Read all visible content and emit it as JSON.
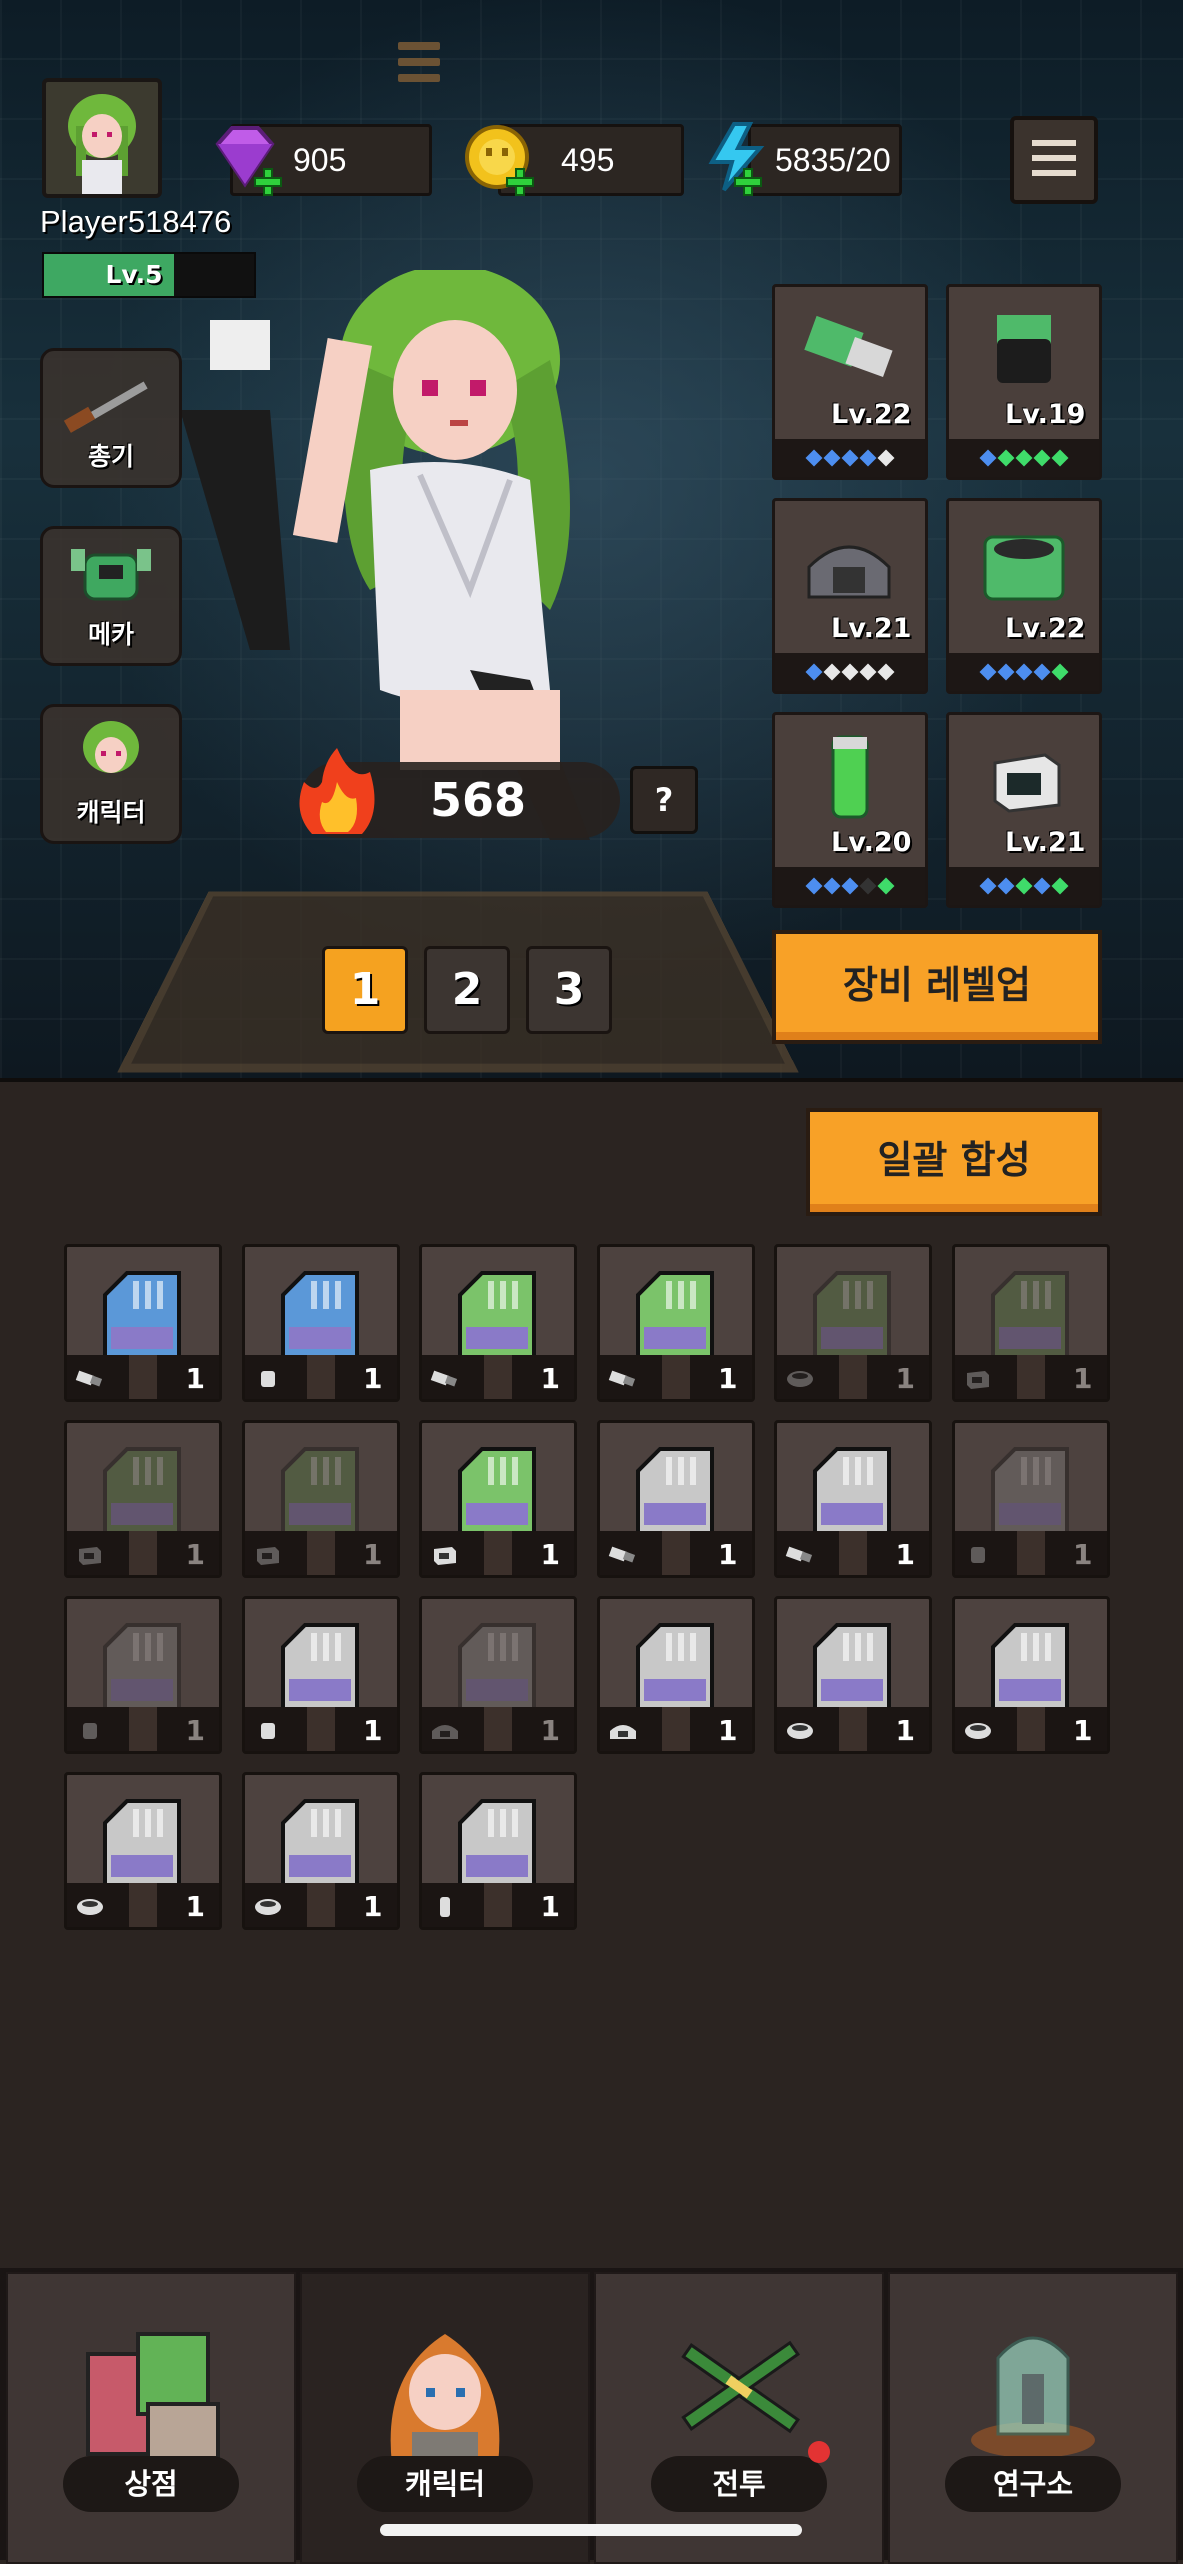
{
  "player": {
    "name": "Player518476",
    "level_text": "Lv.5",
    "exp_progress": 0.62
  },
  "resources": {
    "gems": "905",
    "gold": "495",
    "energy": "5835/20"
  },
  "menu_icon": "hamburger-menu-icon",
  "side_menu": [
    {
      "label": "총기",
      "icon": "rifle-icon"
    },
    {
      "label": "메카",
      "icon": "mech-icon"
    },
    {
      "label": "캐릭터",
      "icon": "character-icon"
    }
  ],
  "combat_power": {
    "value": "568",
    "help": "?"
  },
  "presets": [
    "1",
    "2",
    "3"
  ],
  "equipment": [
    {
      "level": "Lv.22",
      "stars": [
        "blue",
        "blue",
        "blue",
        "blue",
        "white"
      ]
    },
    {
      "level": "Lv.19",
      "stars": [
        "blue",
        "green",
        "green",
        "green",
        "green"
      ]
    },
    {
      "level": "Lv.21",
      "stars": [
        "blue",
        "white",
        "white",
        "white",
        "white"
      ]
    },
    {
      "level": "Lv.22",
      "stars": [
        "blue",
        "blue",
        "blue",
        "blue",
        "green"
      ]
    },
    {
      "level": "Lv.20",
      "stars": [
        "blue",
        "blue",
        "blue",
        "dark",
        "green"
      ]
    },
    {
      "level": "Lv.21",
      "stars": [
        "blue",
        "blue",
        "green",
        "blue",
        "green"
      ]
    }
  ],
  "buttons": {
    "level_up": "장비 레벨업",
    "bulk_merge": "일괄 합성"
  },
  "inventory": [
    {
      "count": "1",
      "color": "#5b98d8",
      "type": "barrel",
      "dim": false
    },
    {
      "count": "1",
      "color": "#5b98d8",
      "type": "canister",
      "dim": false
    },
    {
      "count": "1",
      "color": "#7bc36a",
      "type": "barrel",
      "dim": false
    },
    {
      "count": "1",
      "color": "#7bc36a",
      "type": "barrel",
      "dim": false
    },
    {
      "count": "1",
      "color": "#5e8a4a",
      "type": "ring",
      "dim": true
    },
    {
      "count": "1",
      "color": "#5e8a4a",
      "type": "box",
      "dim": true
    },
    {
      "count": "1",
      "color": "#5e8a4a",
      "type": "box",
      "dim": true
    },
    {
      "count": "1",
      "color": "#5e8a4a",
      "type": "box",
      "dim": true
    },
    {
      "count": "1",
      "color": "#7bc36a",
      "type": "box",
      "dim": false
    },
    {
      "count": "1",
      "color": "#c8c8c8",
      "type": "barrel",
      "dim": false
    },
    {
      "count": "1",
      "color": "#c8c8c8",
      "type": "barrel",
      "dim": false
    },
    {
      "count": "1",
      "color": "#8a8a8a",
      "type": "canister",
      "dim": true
    },
    {
      "count": "1",
      "color": "#8a8a8a",
      "type": "canister",
      "dim": true
    },
    {
      "count": "1",
      "color": "#c8c8c8",
      "type": "canister",
      "dim": false
    },
    {
      "count": "1",
      "color": "#8a8a8a",
      "type": "helmet",
      "dim": true
    },
    {
      "count": "1",
      "color": "#c8c8c8",
      "type": "helmet",
      "dim": false
    },
    {
      "count": "1",
      "color": "#c8c8c8",
      "type": "ring",
      "dim": false
    },
    {
      "count": "1",
      "color": "#c8c8c8",
      "type": "ring",
      "dim": false
    },
    {
      "count": "1",
      "color": "#c8c8c8",
      "type": "ring",
      "dim": false
    },
    {
      "count": "1",
      "color": "#c8c8c8",
      "type": "ring",
      "dim": false
    },
    {
      "count": "1",
      "color": "#c8c8c8",
      "type": "cylinder",
      "dim": false
    }
  ],
  "bottom_nav": [
    {
      "label": "상점",
      "icon": "shop-crates-icon"
    },
    {
      "label": "캐릭터",
      "icon": "character-portrait-icon"
    },
    {
      "label": "전투",
      "icon": "crossed-rifles-icon",
      "notification": true
    },
    {
      "label": "연구소",
      "icon": "lab-jar-icon"
    }
  ]
}
